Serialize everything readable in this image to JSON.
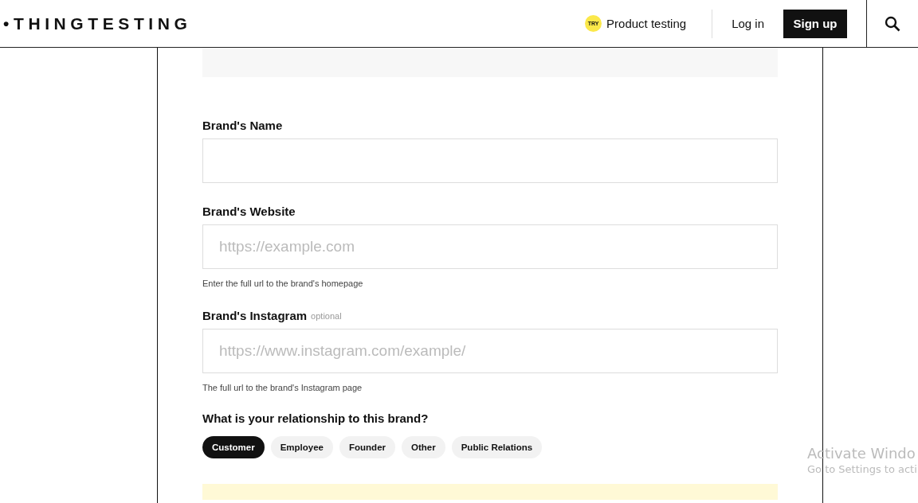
{
  "header": {
    "logo": "•THINGTESTING",
    "badge": "TRY",
    "product_link": "Product testing",
    "login": "Log in",
    "signup": "Sign up"
  },
  "form": {
    "fields": [
      {
        "label": "Brand's Name"
      },
      {
        "label": "Brand's Website",
        "placeholder": "https://example.com",
        "help": "Enter the full url to the brand's homepage"
      },
      {
        "label": "Brand's Instagram",
        "optional": "optional",
        "placeholder": "https://www.instagram.com/example/",
        "help": "The full url to the brand's Instagram page"
      }
    ],
    "relationship": {
      "question": "What is your relationship to this brand?",
      "options": [
        {
          "label": "Customer",
          "selected": true
        },
        {
          "label": "Employee",
          "selected": false
        },
        {
          "label": "Founder",
          "selected": false
        },
        {
          "label": "Other",
          "selected": false
        },
        {
          "label": "Public Relations",
          "selected": false
        }
      ]
    }
  },
  "os_overlay": {
    "title": "Activate Windo",
    "subtitle": "Go to Settings to acti"
  }
}
